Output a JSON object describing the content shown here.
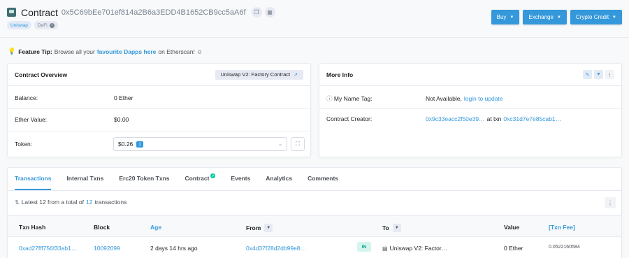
{
  "header": {
    "title": "Contract",
    "address": "0x5C69bEe701ef814a2B6a3EDD4B1652CB9cc5aA6f",
    "tags": [
      "Uniswap",
      "DeFi"
    ],
    "buttons": [
      "Buy",
      "Exchange",
      "Crypto Credit"
    ]
  },
  "tip": {
    "label": "Feature Tip:",
    "text_before": "Browse all your",
    "link": "favourite Dapps here",
    "text_after": "on Etherscan! ☺"
  },
  "overview": {
    "title": "Contract Overview",
    "badge": "Uniswap V2: Factory Contract",
    "balance_label": "Balance:",
    "balance_value": "0 Ether",
    "ether_value_label": "Ether Value:",
    "ether_value": "$0.00",
    "token_label": "Token:",
    "token_value": "$0.26",
    "token_count": "1"
  },
  "more_info": {
    "title": "More Info",
    "name_tag_label": "My Name Tag:",
    "name_tag_value": "Not Available,",
    "name_tag_link": "login to update",
    "creator_label": "Contract Creator:",
    "creator_addr": "0x9c33eacc2f50e39…",
    "creator_at": "at txn",
    "creator_txn": "0xc31d7e7e85cab1…"
  },
  "tabs": [
    "Transactions",
    "Internal Txns",
    "Erc20 Token Txns",
    "Contract",
    "Events",
    "Analytics",
    "Comments"
  ],
  "summary": {
    "prefix": "Latest 12 from a total of",
    "count": "12",
    "suffix": "transactions"
  },
  "table": {
    "headers": [
      "Txn Hash",
      "Block",
      "Age",
      "From",
      "To",
      "Value",
      "[Txn Fee]"
    ],
    "row": {
      "hash": "0xad27fff756f33ab1…",
      "block": "10092099",
      "age": "2 days 14 hrs ago",
      "from": "0x4d37f28d2db99e8…",
      "direction": "IN",
      "to": "Uniswap V2: Factor…",
      "value": "0 Ether",
      "fee": "0.0522160584"
    }
  },
  "colors": {
    "accent": "#3498db",
    "in_badge": "#00a186",
    "verified": "#00c9a7"
  }
}
